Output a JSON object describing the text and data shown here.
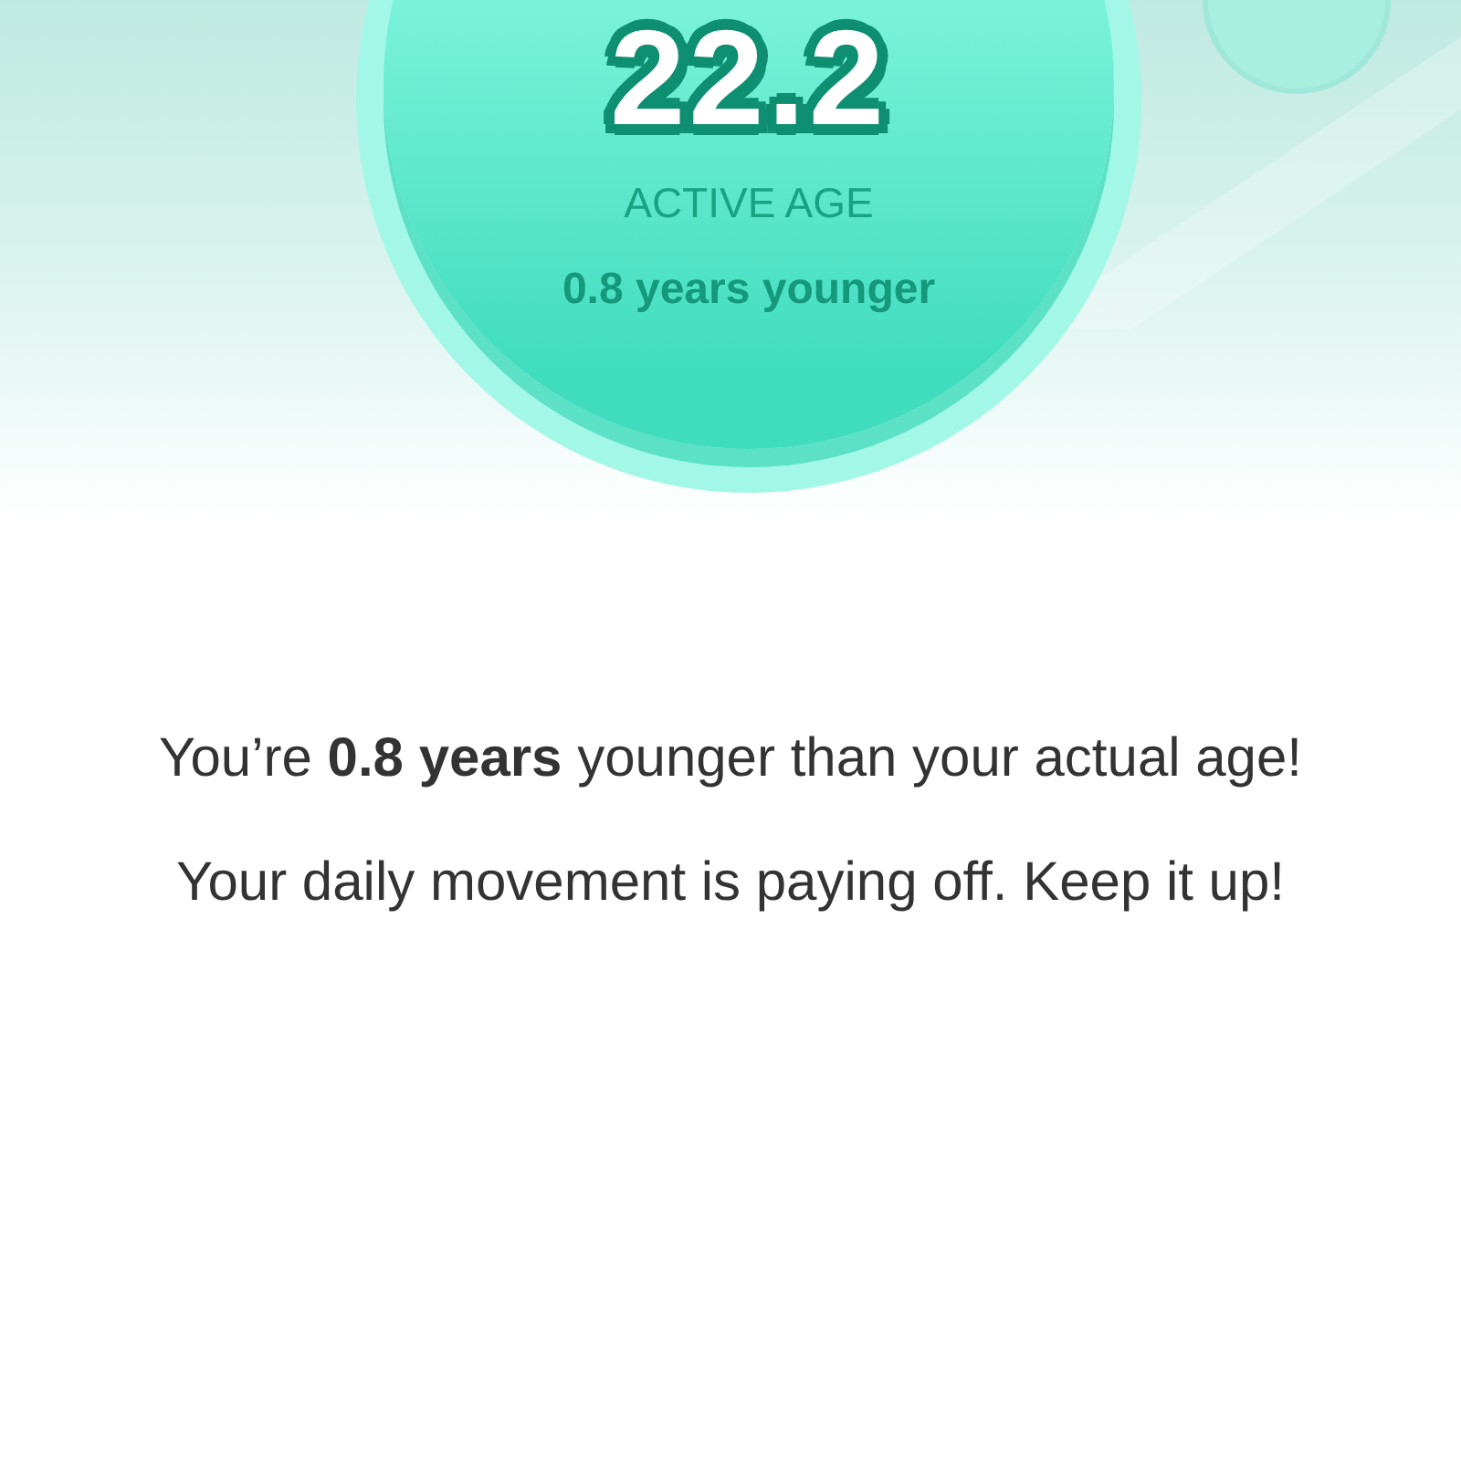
{
  "active_age": {
    "value": "22.2",
    "label": "ACTIVE AGE",
    "difference": "0.8 years younger"
  },
  "message": {
    "headline": "You’re **0.8 years** younger than your actual age!",
    "body": "Your daily movement is paying off. Keep it up!"
  }
}
